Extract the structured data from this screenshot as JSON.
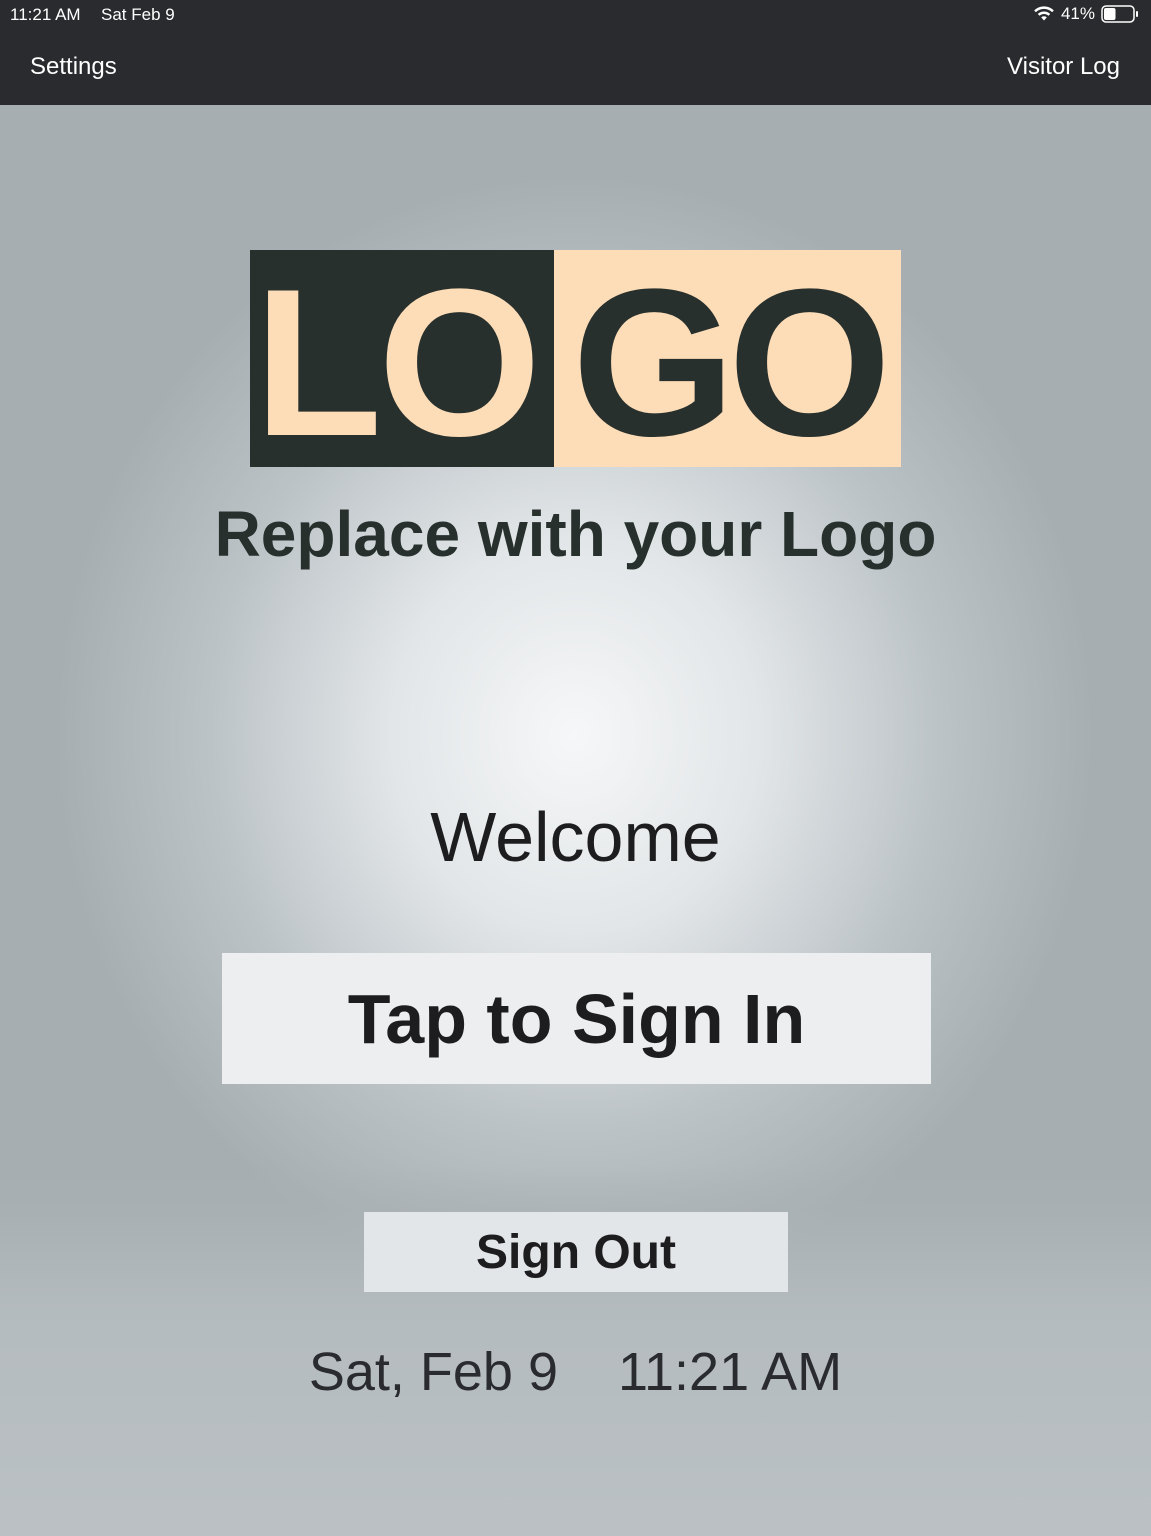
{
  "status_bar": {
    "time": "11:21 AM",
    "date": "Sat Feb 9",
    "battery": "41%",
    "battery_level": 0.41
  },
  "nav": {
    "settings_label": "Settings",
    "visitor_log_label": "Visitor Log"
  },
  "logo": {
    "letters": [
      "L",
      "O",
      "G",
      "O"
    ],
    "subtitle": "Replace with your Logo",
    "colors": {
      "dark": "#27302c",
      "light": "#fddcb8"
    }
  },
  "main": {
    "welcome": "Welcome",
    "sign_in_label": "Tap to Sign In",
    "sign_out_label": "Sign Out",
    "current_date": "Sat, Feb 9",
    "current_time": "11:21 AM"
  },
  "colors": {
    "bar_background": "#2a2b2f",
    "text_dark": "#1d1d1f"
  }
}
